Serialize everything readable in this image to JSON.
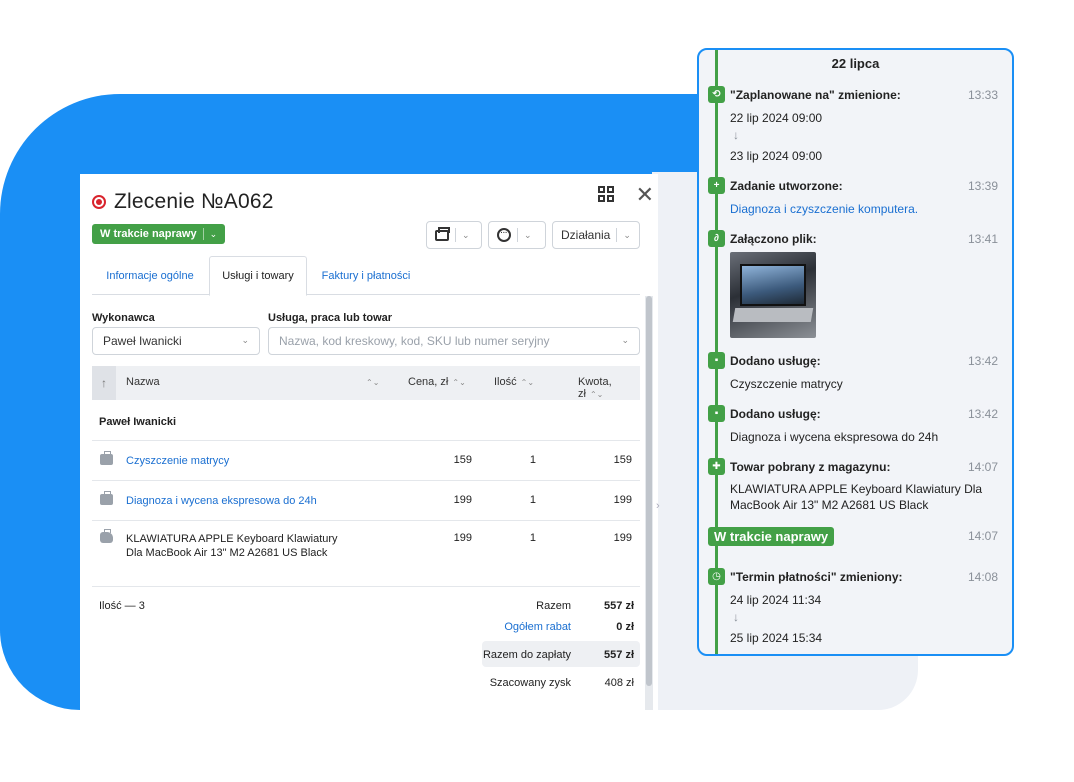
{
  "order": {
    "title": "Zlecenie №A062",
    "close_glyph": "✕",
    "status_label": "W trakcie naprawy",
    "actions_label": "Działania",
    "chevron": "⌄",
    "tabs": [
      {
        "label": "Informacje ogólne",
        "active": false
      },
      {
        "label": "Usługi i towary",
        "active": true
      },
      {
        "label": "Faktury i płatności",
        "active": false
      }
    ],
    "executor_label": "Wykonawca",
    "executor_value": "Paweł Iwanicki",
    "service_label": "Usługa, praca lub towar",
    "service_placeholder": "Nazwa, kod kreskowy, kod, SKU lub numer seryjny",
    "columns": {
      "sort": "↑",
      "name": "Nazwa",
      "price": "Cena, zł",
      "qty": "Ilość",
      "amount": "Kwota, zł",
      "sort_glyph": "⌃⌄"
    },
    "group_name": "Paweł Iwanicki",
    "rows": [
      {
        "name": "Czyszczenie matrycy",
        "price": "159",
        "qty": "1",
        "amount": "159"
      },
      {
        "name": "Diagnoza i wycena ekspresowa do 24h",
        "price": "199",
        "qty": "1",
        "amount": "199"
      },
      {
        "name": "KLAWIATURA APPLE Keyboard Klawiatury Dla MacBook Air 13\" M2 A2681 US Black",
        "price": "199",
        "qty": "1",
        "amount": "199"
      }
    ],
    "qty_total": "Ilość — 3",
    "summary": {
      "total_label": "Razem",
      "total_value": "557 zł",
      "discount_label": "Ogółem rabat",
      "discount_value": "0 zł",
      "to_pay_label": "Razem do zapłaty",
      "to_pay_value": "557 zł",
      "profit_label": "Szacowany zysk",
      "profit_value": "408 zł"
    }
  },
  "timeline": {
    "date": "22 lipca",
    "down_arrow": "↓",
    "events": [
      {
        "title": "\"Zaplanowane na\" zmienione:",
        "time": "13:33",
        "from": "22 lip 2024 09:00",
        "to": "23 lip 2024 09:00"
      },
      {
        "title": "Zadanie utworzone:",
        "time": "13:39",
        "text": "Diagnoza i czyszczenie komputera."
      },
      {
        "title": "Załączono plik:",
        "time": "13:41"
      },
      {
        "title": "Dodano usługę:",
        "time": "13:42",
        "text": "Czyszczenie matrycy"
      },
      {
        "title": "Dodano usługę:",
        "time": "13:42",
        "text": "Diagnoza i wycena ekspresowa do 24h"
      },
      {
        "title": "Towar pobrany z magazynu:",
        "time": "14:07",
        "text": "KLAWIATURA APPLE Keyboard Klawiatury Dla MacBook Air 13\" M2 A2681 US Black"
      },
      {
        "status": "W trakcie naprawy",
        "time": "14:07"
      },
      {
        "title": "\"Termin płatności\" zmieniony:",
        "time": "14:08",
        "from": "24 lip 2024 11:34",
        "to": "25 lip 2024 15:34"
      }
    ]
  },
  "colors": {
    "accent_blue": "#1a8ff5",
    "status_green": "#43a047",
    "link_blue": "#1a6fd1",
    "record_red": "#d9242d"
  }
}
